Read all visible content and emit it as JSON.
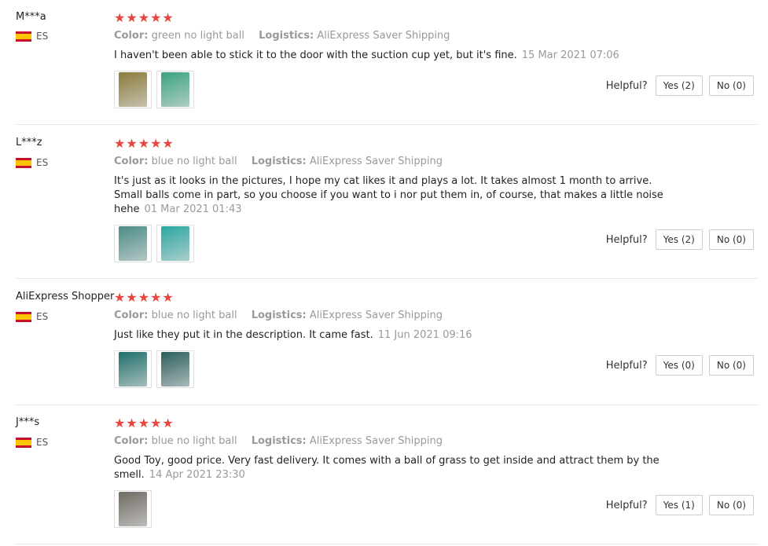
{
  "labels": {
    "color": "Color:",
    "logistics": "Logistics:",
    "helpful": "Helpful?"
  },
  "reviews": [
    {
      "user": "M***a",
      "country": "ES",
      "stars": "★★★★★",
      "color_value": "green no light ball",
      "logistics_value": "AliExpress Saver Shipping",
      "text": "I haven't been able to stick it to the door with the suction cup yet, but it's fine.",
      "date": "15 Mar 2021 07:06",
      "yes": "Yes (2)",
      "no": "No (0)",
      "thumb_colors": [
        "#8a7a3a",
        "#3aa37f"
      ]
    },
    {
      "user": "L***z",
      "country": "ES",
      "stars": "★★★★★",
      "color_value": "blue no light ball",
      "logistics_value": "AliExpress Saver Shipping",
      "text": "It's just as it looks in the pictures, I hope my cat likes it and plays a lot. It takes almost 1 month to arrive. Small balls come in part, so you choose if you want to i nor put them in, of course, that makes a little noise hehe",
      "date": "01 Mar 2021 01:43",
      "yes": "Yes (2)",
      "no": "No (0)",
      "thumb_colors": [
        "#4b8c86",
        "#2aa6a0"
      ]
    },
    {
      "user": "AliExpress Shopper",
      "country": "ES",
      "stars": "★★★★★",
      "color_value": "blue no light ball",
      "logistics_value": "AliExpress Saver Shipping",
      "text": "Just like they put it in the description. It came fast.",
      "date": "11 Jun 2021 09:16",
      "yes": "Yes (0)",
      "no": "No (0)",
      "thumb_colors": [
        "#1f6f6a",
        "#2b5e5c"
      ]
    },
    {
      "user": "J***s",
      "country": "ES",
      "stars": "★★★★★",
      "color_value": "blue no light ball",
      "logistics_value": "AliExpress Saver Shipping",
      "text": "Good Toy, good price. Very fast delivery. It comes with a ball of grass to get inside and attract them by the smell.",
      "date": "14 Apr 2021 23:30",
      "yes": "Yes (1)",
      "no": "No (0)",
      "thumb_colors": [
        "#6f6a63"
      ]
    }
  ]
}
